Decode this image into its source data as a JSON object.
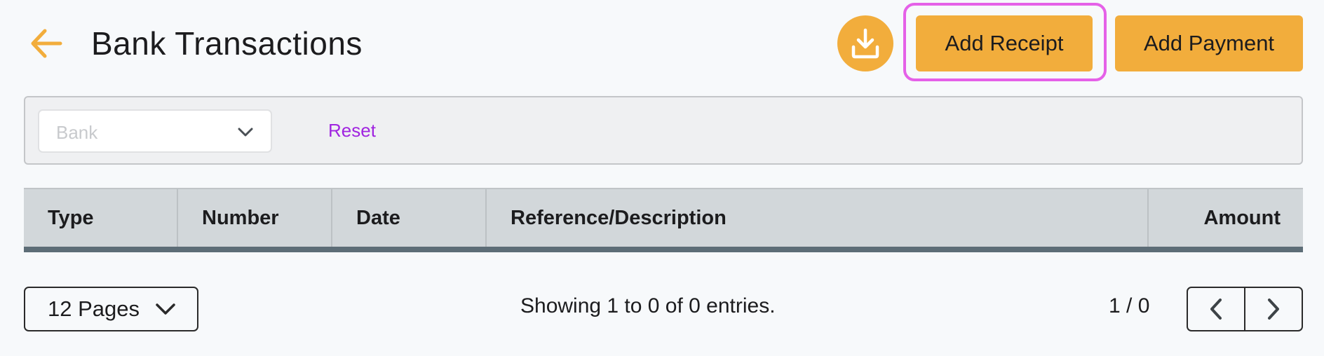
{
  "header": {
    "title": "Bank Transactions",
    "back_icon": "arrow-left-icon",
    "download_icon": "download-icon",
    "add_receipt_label": "Add Receipt",
    "add_payment_label": "Add Payment"
  },
  "colors": {
    "accent": "#f2ad3c",
    "focus_ring": "#e561e8",
    "link": "#a024e0",
    "table_header_bg": "#d2d7da",
    "table_header_border": "#5d6d77"
  },
  "filters": {
    "bank_placeholder": "Bank",
    "bank_value": "",
    "reset_label": "Reset"
  },
  "table": {
    "columns": [
      "Type",
      "Number",
      "Date",
      "Reference/Description",
      "Amount"
    ],
    "rows": []
  },
  "pagination": {
    "page_size_label": "12 Pages",
    "showing_text": "Showing 1 to 0 of 0 entries.",
    "page_indicator": "1 / 0",
    "prev_icon": "chevron-left-icon",
    "next_icon": "chevron-right-icon"
  }
}
